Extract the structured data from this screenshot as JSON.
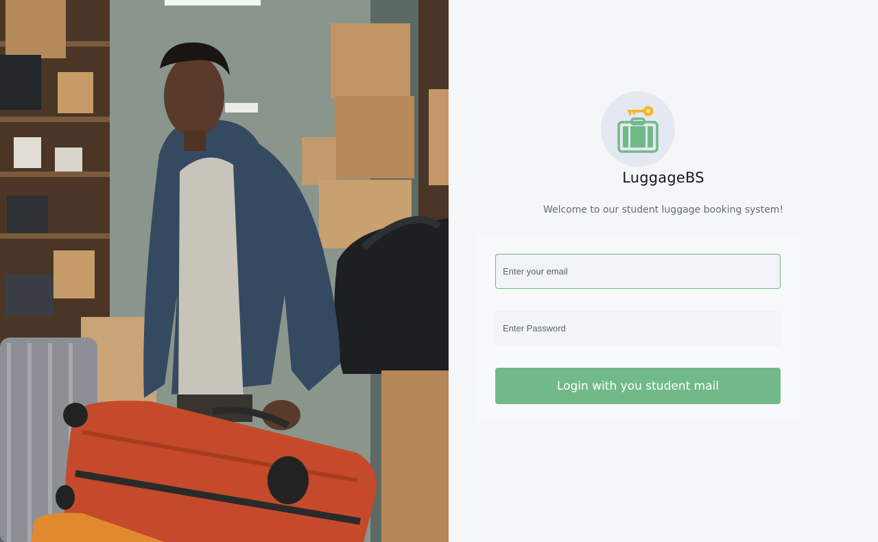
{
  "brand": {
    "name": "LuggageBS",
    "logo_icon": "luggage-key-icon",
    "logo_colors": {
      "suitcase": "#72b98a",
      "key": "#f2b92b",
      "circle": "#e4e8f0"
    }
  },
  "welcome_text": "Welcome to our student luggage booking system!",
  "form": {
    "email": {
      "placeholder": "Enter your email",
      "value": ""
    },
    "password": {
      "placeholder": "Enter Password",
      "value": ""
    },
    "login_label": "Login with you student mail"
  },
  "colors": {
    "accent": "#72b98a",
    "background": "#f5f6f8"
  },
  "hero": {
    "description_icon": "student-with-luggage-photo"
  }
}
